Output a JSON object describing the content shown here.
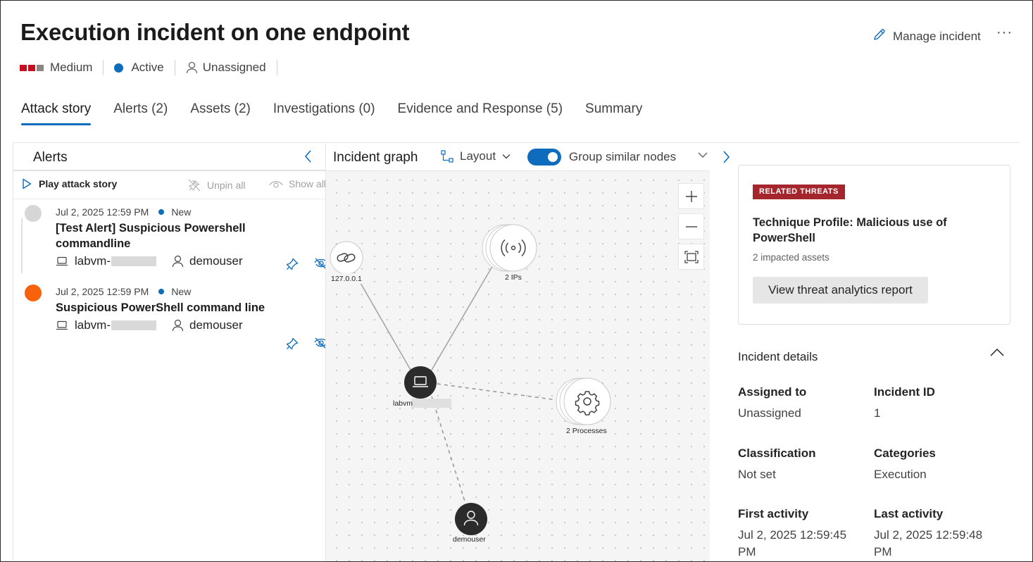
{
  "header": {
    "title": "Execution incident on one endpoint",
    "manage_label": "Manage incident",
    "more_label": "···",
    "severity": "Medium",
    "status": "Active",
    "assignee": "Unassigned",
    "severity_colors": [
      "#c50f1f",
      "#c50f1f",
      "#8a8886"
    ]
  },
  "tabs": [
    {
      "label": "Attack story",
      "active": true
    },
    {
      "label": "Alerts (2)"
    },
    {
      "label": "Assets (2)"
    },
    {
      "label": "Investigations (0)"
    },
    {
      "label": "Evidence and Response (5)"
    },
    {
      "label": "Summary"
    }
  ],
  "alerts_panel": {
    "title": "Alerts",
    "play_label": "Play attack story",
    "unpin_label": "Unpin all",
    "show_label": "Show all",
    "alerts": [
      {
        "date": "Jul 2, 2025 12:59 PM",
        "status": "New",
        "title": "[Test Alert] Suspicious Powershell commandline",
        "device": "labvm-",
        "user": "demouser",
        "severity_color": "#d6d6d6"
      },
      {
        "date": "Jul 2, 2025 12:59 PM",
        "status": "New",
        "title": "Suspicious PowerShell command line",
        "device": "labvm-",
        "user": "demouser",
        "severity_color": "#f7630c"
      }
    ]
  },
  "graph": {
    "title": "Incident graph",
    "layout_label": "Layout",
    "group_label": "Group similar nodes",
    "group_enabled": true,
    "nodes": {
      "url": "127.0.0.1",
      "ips": "2 IPs",
      "device": "labvm",
      "processes": "2 Processes",
      "user": "demouser"
    }
  },
  "related_threats": {
    "badge": "RELATED THREATS",
    "title": "Technique Profile: Malicious use of PowerShell",
    "impacted": "2 impacted assets",
    "button": "View threat analytics report"
  },
  "details": {
    "section": "Incident details",
    "fields": [
      {
        "label": "Assigned to",
        "value": "Unassigned"
      },
      {
        "label": "Incident ID",
        "value": "1"
      },
      {
        "label": "Classification",
        "value": "Not set"
      },
      {
        "label": "Categories",
        "value": "Execution"
      },
      {
        "label": "First activity",
        "value": "Jul 2, 2025 12:59:45 PM"
      },
      {
        "label": "Last activity",
        "value": "Jul 2, 2025 12:59:48 PM"
      }
    ]
  }
}
